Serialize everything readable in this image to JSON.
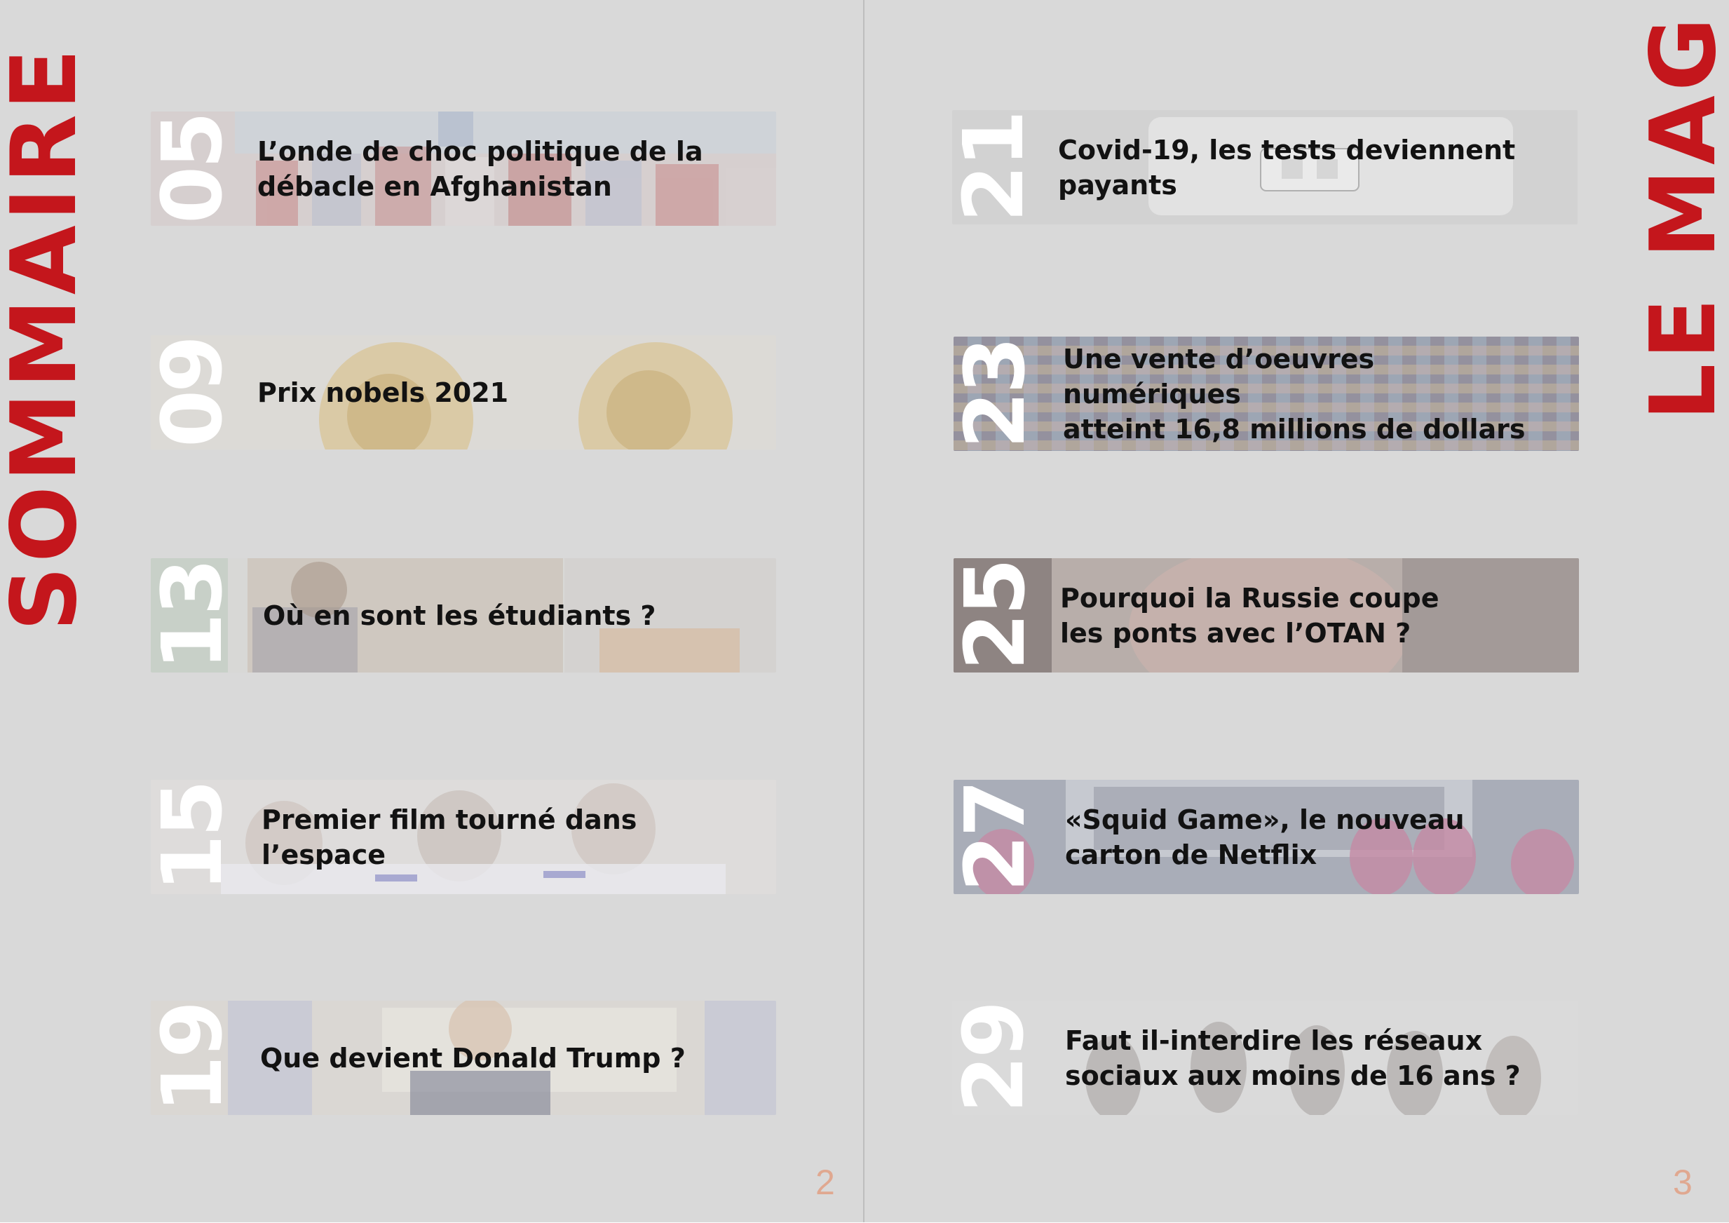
{
  "page_titles": {
    "left": "SOMMAIRE",
    "right": "LE MAG"
  },
  "page_numbers": {
    "left": "2",
    "right": "3"
  },
  "articles_left": [
    {
      "page": "05",
      "title_lines": [
        "L’onde de choc politique de la",
        "débacle en Afghanistan"
      ],
      "image": "american-flags"
    },
    {
      "page": "09",
      "title_lines": [
        "Prix nobels 2021"
      ],
      "image": "nobel-medals"
    },
    {
      "page": "13",
      "title_lines": [
        "Où en sont les étudiants ?"
      ],
      "image": "student-laptop"
    },
    {
      "page": "15",
      "title_lines": [
        "Premier film tourné dans",
        "l’espace"
      ],
      "image": "cosmonauts"
    },
    {
      "page": "19",
      "title_lines": [
        "Que devient Donald Trump ?"
      ],
      "image": "trump-flags"
    }
  ],
  "articles_right": [
    {
      "page": "21",
      "title_lines": [
        "Covid-19, les tests deviennent",
        "payants"
      ],
      "image": "covid-test"
    },
    {
      "page": "23",
      "title_lines": [
        "Une vente d’oeuvres numériques",
        "atteint 16,8 millions de dollars"
      ],
      "image": "digital-art-collage"
    },
    {
      "page": "25",
      "title_lines": [
        "Pourquoi la Russie coupe",
        "les ponts avec l’OTAN ?"
      ],
      "image": "russian-official"
    },
    {
      "page": "27",
      "title_lines": [
        "«Squid Game», le nouveau",
        "carton de Netflix"
      ],
      "image": "squid-game-guards"
    },
    {
      "page": "29",
      "title_lines": [
        "Faut il-interdire les réseaux",
        "sociaux aux moins de 16 ans ?"
      ],
      "image": "teens-phones"
    }
  ]
}
